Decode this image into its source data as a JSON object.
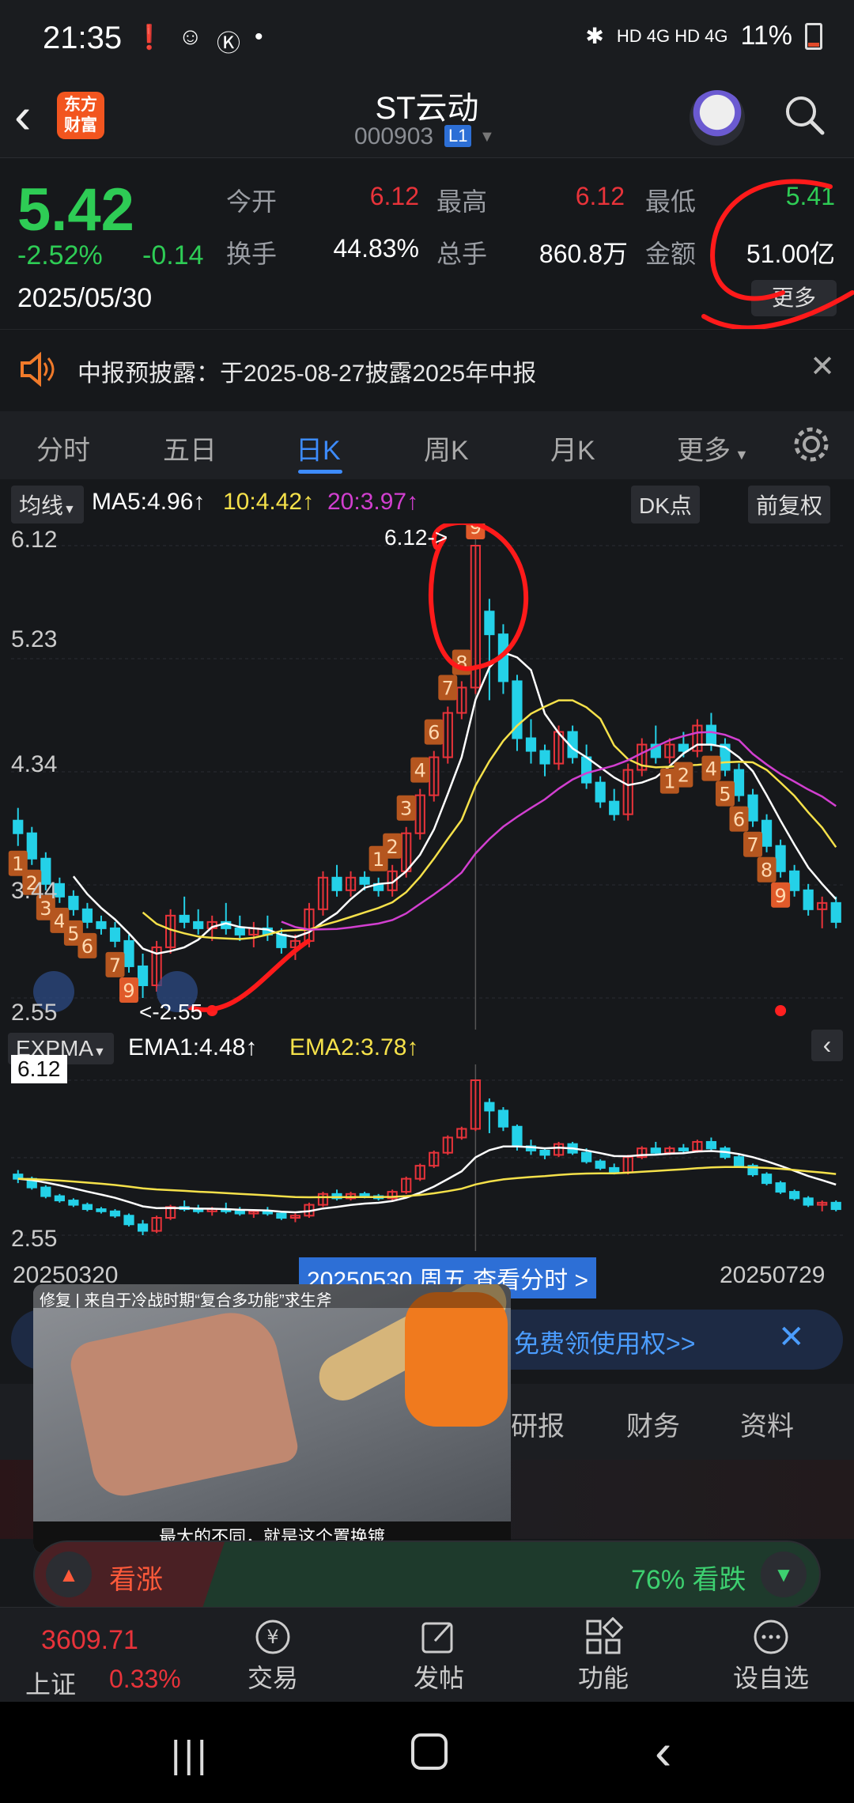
{
  "status_bar": {
    "time": "21:35",
    "network": "HD 4G HD 4G",
    "battery": "11%"
  },
  "header": {
    "logo_text": "东方财富",
    "stock_name": "ST云动",
    "stock_code": "000903",
    "level_badge": "L1"
  },
  "quote": {
    "price": "5.42",
    "change_pct": "-2.52%",
    "change": "-0.14",
    "date": "2025/05/30",
    "open_label": "今开",
    "open": "6.12",
    "high_label": "最高",
    "high": "6.12",
    "low_label": "最低",
    "low": "5.41",
    "turnover_label": "换手",
    "turnover": "44.83%",
    "volume_label": "总手",
    "volume": "860.8万",
    "amount_label": "金额",
    "amount": "51.00亿",
    "more_label": "更多"
  },
  "notice": {
    "text": "中报预披露：于2025-08-27披露2025年中报"
  },
  "tabs": [
    "分时",
    "五日",
    "日K",
    "周K",
    "月K",
    "更多"
  ],
  "active_tab": "日K",
  "chart_toolbar": {
    "ma_selector": "均线",
    "ma5": "MA5:4.96↑",
    "ma10": "10:4.42↑",
    "ma20": "20:3.97↑",
    "dk_label": "DK点",
    "adjust_label": "前复权"
  },
  "chart_data": {
    "type": "candlestick",
    "y_ticks": [
      "6.12",
      "5.23",
      "4.34",
      "3.44",
      "2.55"
    ],
    "max_label": "6.12->",
    "min_label": "<-2.55",
    "x_start": "20250320",
    "x_end": "20250729",
    "cursor_label": "20250530 周五 查看分时 >",
    "ema_panel": {
      "selector": "EXPMA",
      "ema1": "EMA1:4.48↑",
      "ema2": "EMA2:3.78↑",
      "top_label": "6.12",
      "y_top": "6.12",
      "y_bottom": "2.55"
    },
    "candles": [
      [
        3.95,
        4.05,
        3.75,
        3.85
      ],
      [
        3.85,
        3.9,
        3.6,
        3.65
      ],
      [
        3.65,
        3.7,
        3.4,
        3.45
      ],
      [
        3.45,
        3.5,
        3.3,
        3.35
      ],
      [
        3.35,
        3.4,
        3.2,
        3.25
      ],
      [
        3.25,
        3.3,
        3.1,
        3.15
      ],
      [
        3.15,
        3.2,
        3.05,
        3.1
      ],
      [
        3.1,
        3.15,
        2.95,
        3.0
      ],
      [
        3.0,
        3.05,
        2.75,
        2.8
      ],
      [
        2.8,
        2.9,
        2.55,
        2.65
      ],
      [
        2.65,
        3.0,
        2.6,
        2.95
      ],
      [
        2.95,
        3.25,
        2.9,
        3.2
      ],
      [
        3.2,
        3.35,
        3.1,
        3.15
      ],
      [
        3.15,
        3.25,
        3.05,
        3.1
      ],
      [
        3.1,
        3.2,
        3.0,
        3.15
      ],
      [
        3.15,
        3.3,
        3.05,
        3.1
      ],
      [
        3.1,
        3.2,
        3.0,
        3.05
      ],
      [
        3.05,
        3.15,
        2.95,
        3.1
      ],
      [
        3.1,
        3.2,
        3.0,
        3.05
      ],
      [
        3.05,
        3.1,
        2.9,
        2.95
      ],
      [
        2.95,
        3.05,
        2.85,
        3.0
      ],
      [
        3.0,
        3.3,
        2.95,
        3.25
      ],
      [
        3.25,
        3.55,
        3.2,
        3.5
      ],
      [
        3.5,
        3.6,
        3.35,
        3.4
      ],
      [
        3.4,
        3.55,
        3.35,
        3.5
      ],
      [
        3.5,
        3.55,
        3.4,
        3.45
      ],
      [
        3.45,
        3.5,
        3.35,
        3.4
      ],
      [
        3.4,
        3.6,
        3.35,
        3.55
      ],
      [
        3.55,
        3.9,
        3.5,
        3.85
      ],
      [
        3.85,
        4.2,
        3.8,
        4.15
      ],
      [
        4.15,
        4.5,
        4.1,
        4.45
      ],
      [
        4.45,
        4.85,
        4.4,
        4.8
      ],
      [
        4.8,
        5.05,
        4.75,
        5.0
      ],
      [
        5.0,
        6.12,
        4.95,
        6.12
      ],
      [
        5.6,
        5.7,
        4.9,
        5.42
      ],
      [
        5.42,
        5.5,
        4.95,
        5.05
      ],
      [
        5.05,
        5.1,
        4.5,
        4.6
      ],
      [
        4.6,
        4.75,
        4.4,
        4.5
      ],
      [
        4.5,
        4.55,
        4.3,
        4.4
      ],
      [
        4.4,
        4.7,
        4.35,
        4.65
      ],
      [
        4.65,
        4.7,
        4.4,
        4.45
      ],
      [
        4.45,
        4.55,
        4.2,
        4.25
      ],
      [
        4.25,
        4.3,
        4.05,
        4.1
      ],
      [
        4.1,
        4.2,
        3.95,
        4.0
      ],
      [
        4.0,
        4.4,
        3.95,
        4.35
      ],
      [
        4.35,
        4.6,
        4.3,
        4.55
      ],
      [
        4.55,
        4.7,
        4.4,
        4.45
      ],
      [
        4.45,
        4.6,
        4.4,
        4.55
      ],
      [
        4.55,
        4.65,
        4.45,
        4.5
      ],
      [
        4.5,
        4.75,
        4.45,
        4.7
      ],
      [
        4.7,
        4.8,
        4.5,
        4.55
      ],
      [
        4.55,
        4.6,
        4.3,
        4.35
      ],
      [
        4.35,
        4.4,
        4.1,
        4.15
      ],
      [
        4.15,
        4.2,
        3.9,
        3.95
      ],
      [
        3.95,
        4.0,
        3.7,
        3.75
      ],
      [
        3.75,
        3.8,
        3.5,
        3.55
      ],
      [
        3.55,
        3.6,
        3.35,
        3.4
      ],
      [
        3.4,
        3.45,
        3.2,
        3.25
      ],
      [
        3.25,
        3.35,
        3.1,
        3.3
      ],
      [
        3.3,
        3.35,
        3.1,
        3.15
      ]
    ]
  },
  "ad_banner": {
    "text": "免费领使用权>>"
  },
  "video": {
    "title": "修复 | 来自于冷战时期“复合多功能”求生斧",
    "caption": "最大的不同，就是这个置换镀"
  },
  "bottom_tabs": [
    "研报",
    "财务",
    "资料"
  ],
  "sentiment": {
    "up_label": "看涨",
    "down_label": "76% 看跌"
  },
  "bottom_nav": {
    "index_value": "3609.71",
    "index_name": "上证",
    "index_change": "0.33%",
    "items": [
      "交易",
      "发帖",
      "功能",
      "设自选"
    ]
  },
  "colors": {
    "up": "#e8333a",
    "down": "#2ecc55",
    "accent": "#3d8bfd",
    "ma5": "#ffffff",
    "ma10": "#f5e14a",
    "ma20": "#d23fd0"
  }
}
